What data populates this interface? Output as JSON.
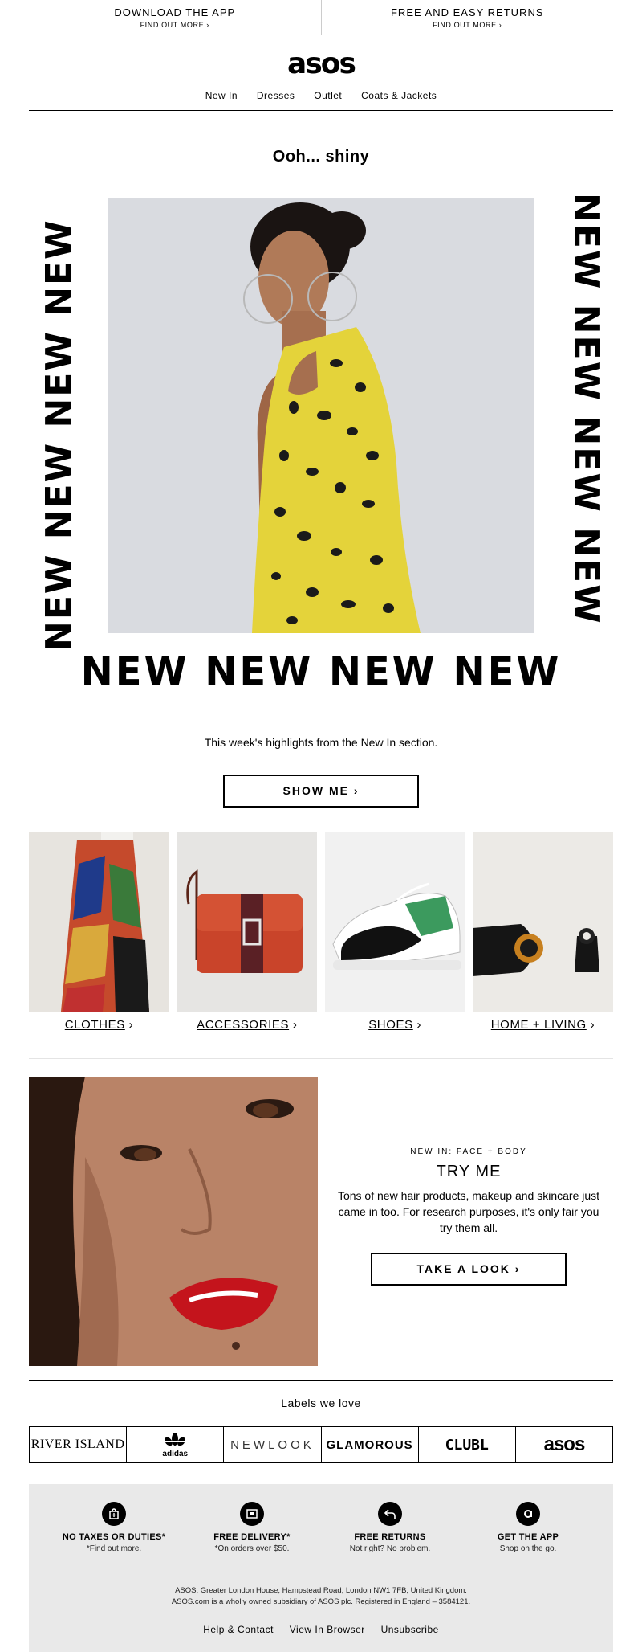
{
  "topbar": {
    "left_title": "DOWNLOAD THE APP",
    "left_link": "FIND OUT MORE ›",
    "right_title": "FREE AND EASY RETURNS",
    "right_link": "FIND OUT MORE ›"
  },
  "logo": "asos",
  "nav": [
    "New In",
    "Dresses",
    "Outlet",
    "Coats & Jackets"
  ],
  "headline": "Ooh... shiny",
  "new_word": "NEW NEW NEW NEW",
  "highlight_text": "This week's highlights from the New In section.",
  "show_me_button": "SHOW ME ›",
  "categories": [
    {
      "label": "CLOTHES",
      "arrow": "›"
    },
    {
      "label": "ACCESSORIES",
      "arrow": "›"
    },
    {
      "label": "SHOES",
      "arrow": "›"
    },
    {
      "label": "HOME + LIVING",
      "arrow": "›"
    }
  ],
  "promo": {
    "kicker": "NEW IN: FACE + BODY",
    "title": "TRY ME",
    "body": "Tons of new hair products, makeup and skincare just came in too. For research purposes, it's only fair you try them all.",
    "button": "TAKE A LOOK ›"
  },
  "labels_title": "Labels we love",
  "brands": [
    "RIVER ISLAND",
    "adidas",
    "NEWLOOK",
    "GLAMOROUS",
    "CLUBL",
    "asos"
  ],
  "perks": [
    {
      "title": "NO TAXES OR DUTIES*",
      "sub": "*Find out more.",
      "icon": "tax-bag-icon"
    },
    {
      "title": "FREE DELIVERY*",
      "sub": "*On orders over $50.",
      "icon": "delivery-truck-icon"
    },
    {
      "title": "FREE RETURNS",
      "sub": "Not right? No problem.",
      "icon": "return-arrow-icon"
    },
    {
      "title": "GET THE APP",
      "sub": "Shop on the go.",
      "icon": "asos-app-icon"
    }
  ],
  "address_line1": "ASOS, Greater London House, Hampstead Road, London NW1 7FB, United Kingdom.",
  "address_line2": "ASOS.com is a wholly owned subsidiary of ASOS plc. Registered in England – 3584121.",
  "footer_links": [
    "Help & Contact",
    "View In Browser",
    "Unsubscribe"
  ]
}
